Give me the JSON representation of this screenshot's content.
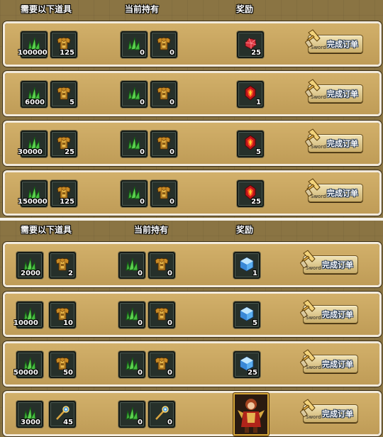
{
  "headers": {
    "required": "需要以下道具",
    "owned": "当前持有",
    "reward": "奖励"
  },
  "button": {
    "label": "完成订单",
    "sub": "Sword"
  },
  "colors": {
    "frame": "#f2eadb",
    "row_fill": "#c8a660",
    "slot": "#26302a"
  },
  "top_orders": [
    {
      "req_grass": "100000",
      "req_armor": "125",
      "own_grass": "0",
      "own_armor": "0",
      "reward_icon": "ruby-gem-icon",
      "reward_count": "25"
    },
    {
      "req_grass": "6000",
      "req_armor": "5",
      "own_grass": "0",
      "own_armor": "0",
      "reward_icon": "fire-orb-icon",
      "reward_count": "1"
    },
    {
      "req_grass": "30000",
      "req_armor": "25",
      "own_grass": "0",
      "own_armor": "0",
      "reward_icon": "fire-orb-icon",
      "reward_count": "5"
    },
    {
      "req_grass": "150000",
      "req_armor": "125",
      "own_grass": "0",
      "own_armor": "0",
      "reward_icon": "fire-orb-icon",
      "reward_count": "25"
    }
  ],
  "bottom_orders": [
    {
      "req_grass": "2000",
      "req_item": "2",
      "req_icon": "armor-icon",
      "own_grass": "0",
      "own_item": "0",
      "reward_icon": "ice-cube-icon",
      "reward_count": "1"
    },
    {
      "req_grass": "10000",
      "req_item": "10",
      "req_icon": "armor-icon",
      "own_grass": "0",
      "own_item": "0",
      "reward_icon": "ice-cube-icon",
      "reward_count": "5"
    },
    {
      "req_grass": "50000",
      "req_item": "50",
      "req_icon": "armor-icon",
      "own_grass": "0",
      "own_item": "0",
      "reward_icon": "ice-cube-icon",
      "reward_count": "25"
    },
    {
      "req_grass": "3000",
      "req_item": "45",
      "req_icon": "staff-icon",
      "own_grass": "0",
      "own_item": "0",
      "reward_icon": "character-portrait-icon",
      "reward_count": ""
    }
  ]
}
